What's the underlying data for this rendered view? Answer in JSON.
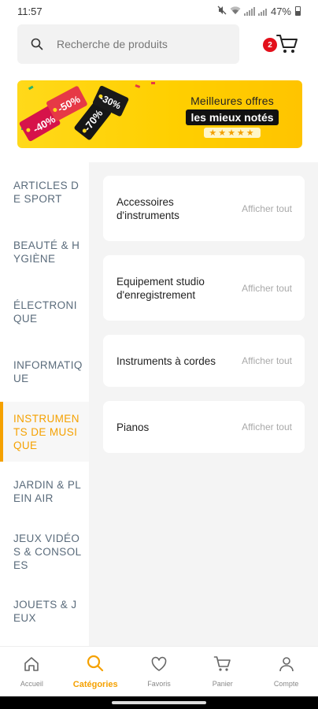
{
  "status_bar": {
    "time": "11:57",
    "battery": "47%"
  },
  "search": {
    "placeholder": "Recherche de produits"
  },
  "cart": {
    "count": "2"
  },
  "banner": {
    "line1": "Meilleures offres",
    "line2": "les mieux notés",
    "stars": "★★★★★",
    "tags": [
      "-40%",
      "-50%",
      "-70%",
      "-30%"
    ]
  },
  "categories": [
    {
      "label": "ARTICLES DE SPORT",
      "active": false
    },
    {
      "label": "BEAUTÉ & HYGIÈNE",
      "active": false
    },
    {
      "label": "ÉLECTRONIQUE",
      "active": false
    },
    {
      "label": "INFORMATIQUE",
      "active": false
    },
    {
      "label": "INSTRUMENTS DE MUSIQUE",
      "active": true
    },
    {
      "label": "JARDIN & PLEIN AIR",
      "active": false
    },
    {
      "label": "JEUX VIDÉOS & CONSOLES",
      "active": false
    },
    {
      "label": "JOUETS & JEUX",
      "active": false
    }
  ],
  "subcategories": [
    {
      "name": "Accessoires d'instruments",
      "link": "Afficher tout"
    },
    {
      "name": "Equipement studio d'enregistrement",
      "link": "Afficher tout"
    },
    {
      "name": "Instruments à cordes",
      "link": "Afficher tout"
    },
    {
      "name": "Pianos",
      "link": "Afficher tout"
    }
  ],
  "bottom_nav": [
    {
      "label": "Accueil",
      "icon": "home-icon",
      "active": false
    },
    {
      "label": "Catégories",
      "icon": "search-icon",
      "active": true
    },
    {
      "label": "Favoris",
      "icon": "heart-icon",
      "active": false
    },
    {
      "label": "Panier",
      "icon": "cart-icon",
      "active": false
    },
    {
      "label": "Compte",
      "icon": "user-icon",
      "active": false
    }
  ],
  "colors": {
    "accent": "#f5a100",
    "badge": "#e3101b",
    "category_text": "#5a6b7b"
  }
}
